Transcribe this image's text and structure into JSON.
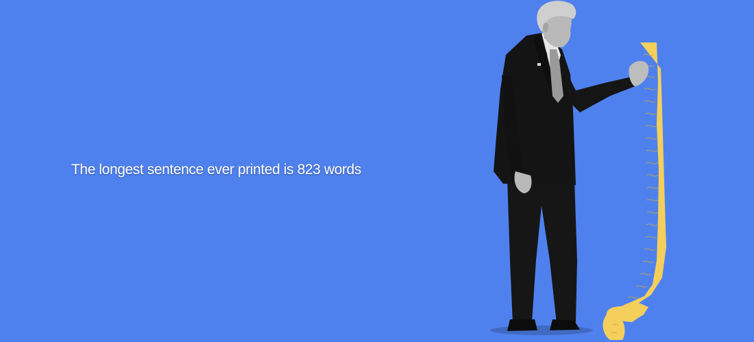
{
  "colors": {
    "background": "#4f81ee",
    "text": "#ffffff",
    "suit": "#141414",
    "shirt": "#e6e6e6",
    "hair": "#cfcfcf",
    "skin": "#b9b9b9",
    "receipt": "#f4cf5c",
    "receipt_lines": "#c9a840"
  },
  "headline": {
    "text": "The longest sentence ever printed is 823 words"
  },
  "illustration": {
    "subject_icon": "man-in-suit-holding-long-receipt"
  }
}
